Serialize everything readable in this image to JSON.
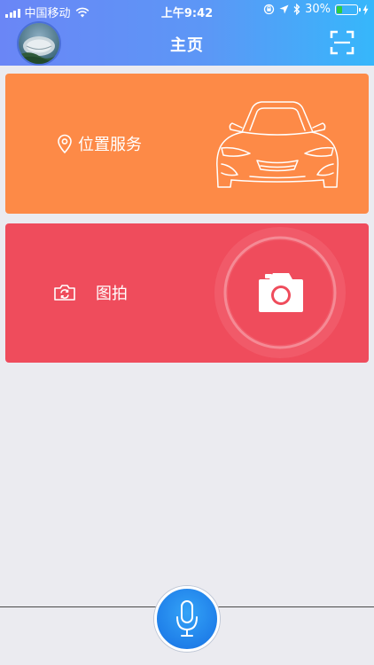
{
  "status_bar": {
    "carrier": "中国移动",
    "time": "上午9:42",
    "battery_percent": "30%",
    "battery_level": 0.3,
    "battery_color": "#2ecc40"
  },
  "nav": {
    "title": "主页",
    "avatar_icon": "avatar-radio-telescope",
    "scan_icon": "scan-icon"
  },
  "cards": [
    {
      "label": "位置服务",
      "icon": "location-pin-icon",
      "illustration": "car-outline-icon",
      "color": "#fd8a47"
    },
    {
      "label": "图拍",
      "icon": "camera-rotate-icon",
      "illustration": "camera-icon",
      "color": "#ef4c5c"
    }
  ],
  "bottom": {
    "mic_icon": "microphone-icon"
  },
  "colors": {
    "header_start": "#6a86f6",
    "header_end": "#36b7fb",
    "background": "#ebebf0",
    "mic": "#1f7fe9"
  }
}
